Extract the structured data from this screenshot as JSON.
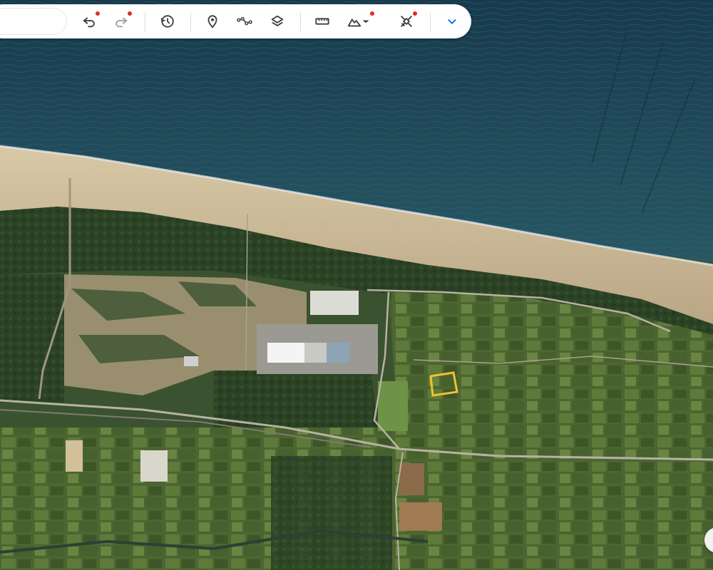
{
  "toolbar": {
    "search": {
      "value": "",
      "placeholder": ""
    },
    "buttons": [
      {
        "name": "undo",
        "icon": "undo-icon",
        "has_dot": true
      },
      {
        "name": "redo",
        "icon": "redo-icon",
        "has_dot": true,
        "disabled": true
      },
      {
        "name": "historical-imagery",
        "icon": "history-icon"
      },
      {
        "name": "add-placemark",
        "icon": "placemark-icon"
      },
      {
        "name": "add-path",
        "icon": "path-icon"
      },
      {
        "name": "layers",
        "icon": "layers-icon"
      },
      {
        "name": "measure",
        "icon": "ruler-icon"
      },
      {
        "name": "map-style",
        "icon": "terrain-icon",
        "has_dot": true,
        "has_dropdown": true
      },
      {
        "name": "satellite-tools",
        "icon": "satellite-icon",
        "has_dot": true
      },
      {
        "name": "expand",
        "icon": "chevron-down-icon"
      }
    ]
  },
  "colors": {
    "notification_dot": "#d93025",
    "accent": "#1a73e8",
    "icon": "#3c4043",
    "icon_disabled": "#9aa0a6",
    "selection_outline": "#f2c230",
    "sea": "#1d4a5c",
    "beach": "#c8b491",
    "forest": "#2c4226",
    "field": "#556f35",
    "road": "#b8b2a4"
  },
  "map": {
    "view": "satellite",
    "features": [
      "sea",
      "beach",
      "dunes",
      "forest",
      "fields",
      "roads",
      "industrial-buildings",
      "selected-parcel"
    ]
  }
}
